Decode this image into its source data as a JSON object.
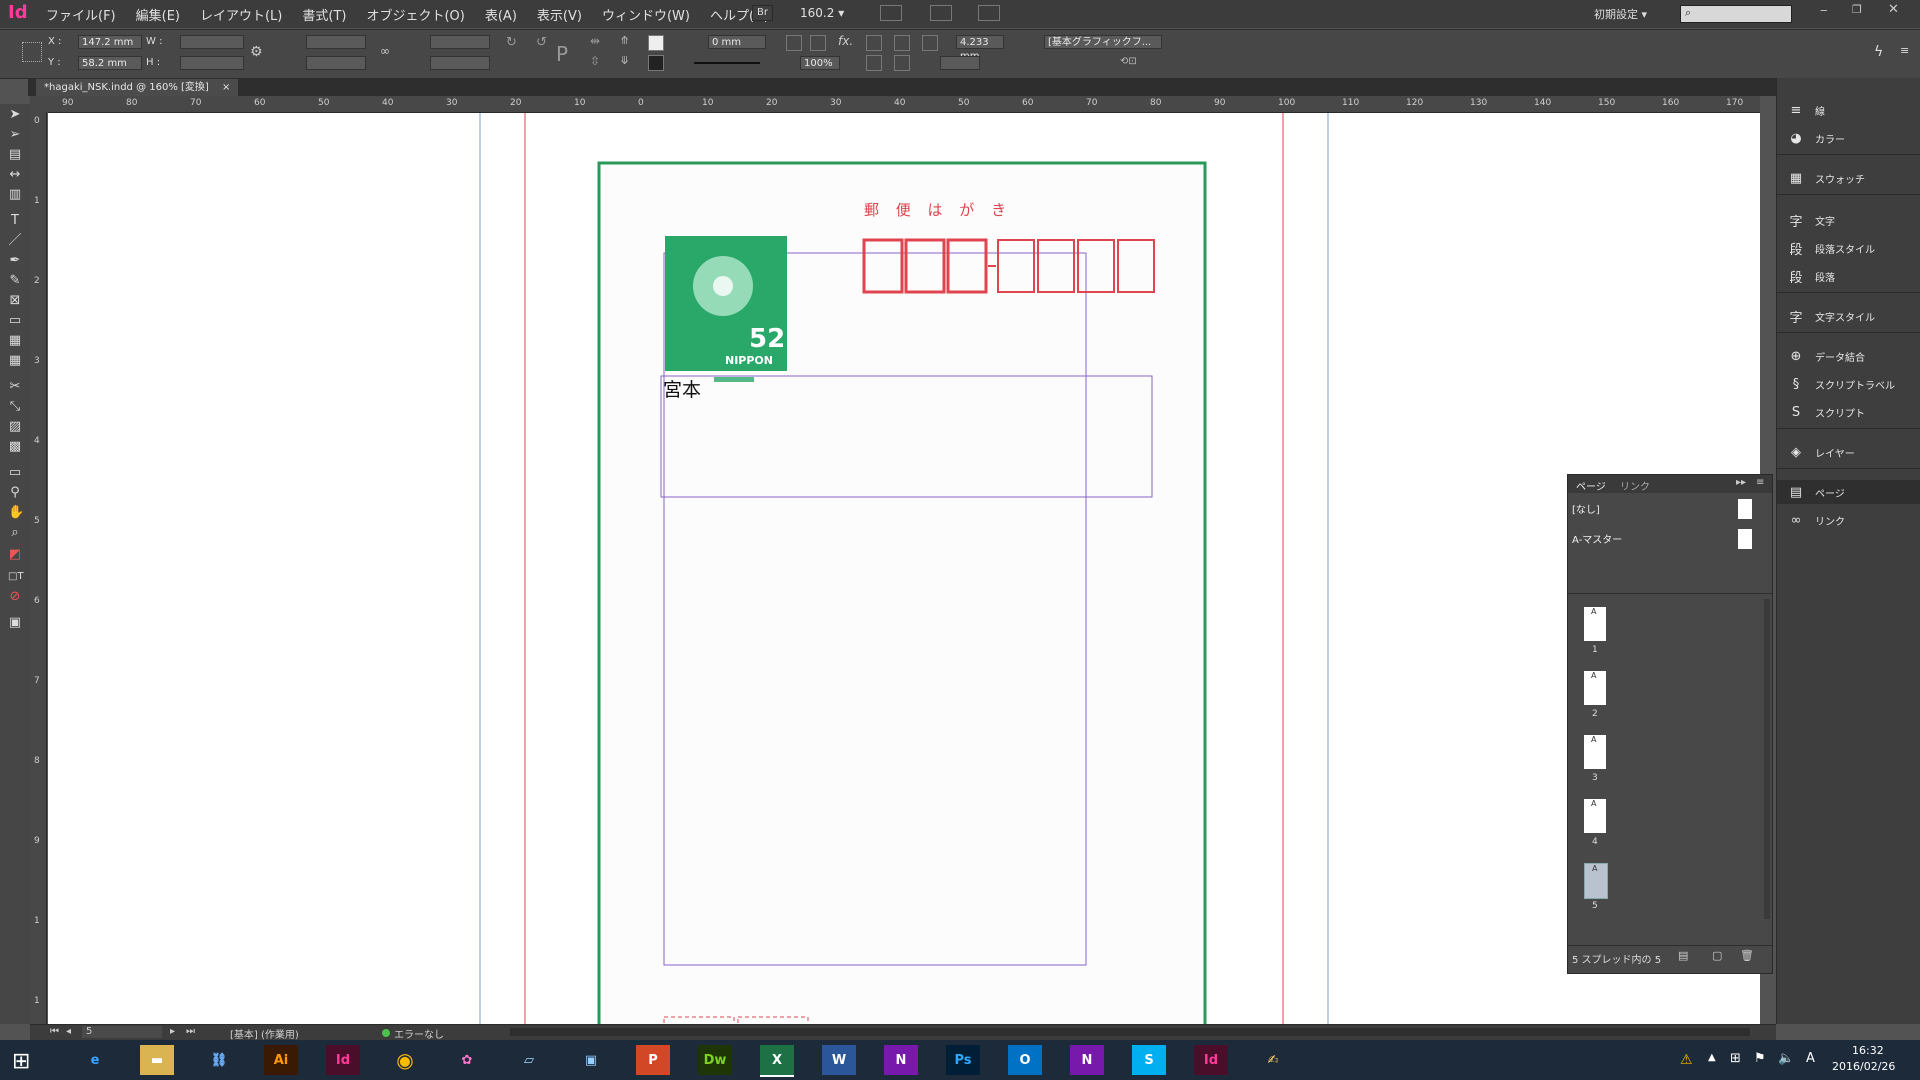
{
  "menubar": {
    "app_icon": "Id",
    "menus": [
      "ファイル(F)",
      "編集(E)",
      "レイアウト(L)",
      "書式(T)",
      "オブジェクト(O)",
      "表(A)",
      "表示(V)",
      "ウィンドウ(W)",
      "ヘルプ(H)"
    ],
    "bridge_label": "Br",
    "zoom": "160.2",
    "workspace": "初期設定",
    "window_controls": [
      "minimize",
      "restore",
      "close"
    ]
  },
  "control": {
    "x_label": "X :",
    "x_value": "147.2 mm",
    "y_label": "Y :",
    "y_value": "58.2 mm",
    "w_label": "W :",
    "h_label": "H :",
    "stroke_weight": "0 mm",
    "opacity": "100%",
    "ref_value": "4.233 mm",
    "object_style": "[基本グラフィックフ..."
  },
  "document": {
    "tab_title": "*hagaki_NSK.indd @ 160% [変換]",
    "close_label": "×"
  },
  "rulers": {
    "h_ticks": [
      "90",
      "80",
      "70",
      "60",
      "50",
      "40",
      "30",
      "20",
      "10",
      "0",
      "10",
      "20",
      "30",
      "40",
      "50",
      "60",
      "70",
      "80",
      "90",
      "100",
      "110",
      "120",
      "130",
      "140",
      "150",
      "160",
      "170"
    ],
    "v_ticks": [
      "0",
      "1",
      "2",
      "3",
      "4",
      "5",
      "6",
      "7",
      "8",
      "9",
      "1",
      "1"
    ]
  },
  "postcard": {
    "header": "郵 便 は が き",
    "stamp_value": "52",
    "stamp_country": "NIPPON",
    "recipient_text": "宮本",
    "colors": {
      "border": "#2a9a5a",
      "red": "#e0444e",
      "purple": "#8a63c8",
      "guide_blue": "#7b9cd6",
      "stamp": "#2aa86a"
    }
  },
  "dock": {
    "items": [
      {
        "icon": "stroke-icon",
        "label": "線"
      },
      {
        "icon": "color-icon",
        "label": "カラー"
      },
      {
        "icon": "swatches-icon",
        "label": "スウォッチ"
      },
      {
        "icon": "character-icon",
        "label": "文字"
      },
      {
        "icon": "paragraph-styles-icon",
        "label": "段落スタイル"
      },
      {
        "icon": "paragraph-icon",
        "label": "段落"
      },
      {
        "icon": "character-styles-icon",
        "label": "文字スタイル"
      },
      {
        "icon": "data-merge-icon",
        "label": "データ結合"
      },
      {
        "icon": "script-label-icon",
        "label": "スクリプトラベル"
      },
      {
        "icon": "scripts-icon",
        "label": "スクリプト"
      },
      {
        "icon": "layers-icon",
        "label": "レイヤー"
      },
      {
        "icon": "pages-icon",
        "label": "ページ"
      },
      {
        "icon": "links-icon",
        "label": "リンク"
      }
    ]
  },
  "pages_panel": {
    "tab_pages": "ページ",
    "tab_links": "リンク",
    "masters": [
      "[なし]",
      "A-マスター"
    ],
    "pages": [
      {
        "letter": "A",
        "number": "1"
      },
      {
        "letter": "A",
        "number": "2"
      },
      {
        "letter": "A",
        "number": "3"
      },
      {
        "letter": "A",
        "number": "4"
      },
      {
        "letter": "A",
        "number": "5"
      }
    ],
    "footer": "5 スプレッド内の 5"
  },
  "status": {
    "page_field": "5",
    "master_label": "[基本] (作業用)",
    "preflight": "エラーなし"
  },
  "taskbar": {
    "apps": [
      "ie-icon",
      "explorer-icon",
      "network-icon",
      "Ai",
      "Id",
      "chrome-icon",
      "photos-icon",
      "notes-icon",
      "remote-icon",
      "P",
      "Dw",
      "X",
      "W",
      "N",
      "Ps",
      "O",
      "N",
      "S",
      "Id",
      "misc-icon"
    ],
    "time": "16:32",
    "date": "2016/02/26",
    "ime": "A"
  }
}
